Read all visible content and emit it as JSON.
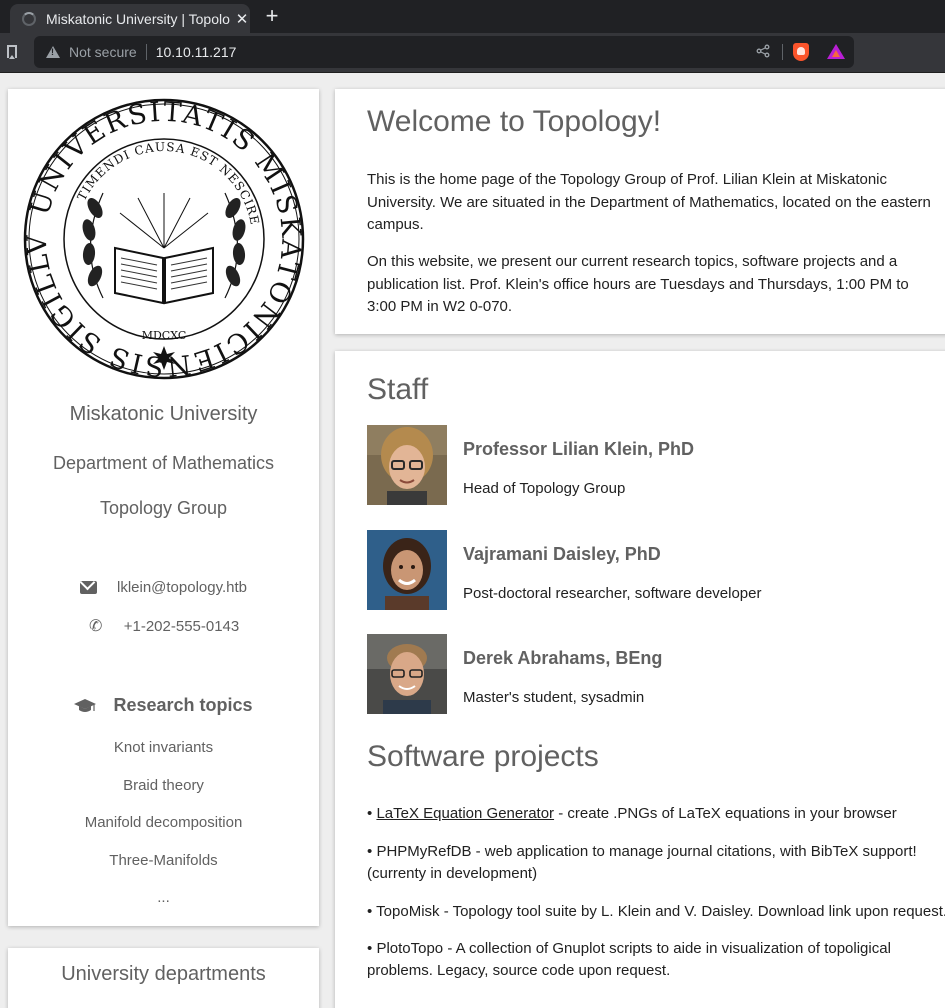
{
  "browser": {
    "tab_title": "Miskatonic University | Topology Group",
    "security_label": "Not secure",
    "url": "10.10.11.217"
  },
  "sidebar": {
    "seal": {
      "outer_text": "UNIVERSITATIS MISKATONICIENSIS SIGILLVM",
      "inner_text": "TIMENDI CAUSA EST NESCIRE",
      "year": "MDCXC"
    },
    "university": "Miskatonic University",
    "department": "Department of Mathematics",
    "group": "Topology Group",
    "email": "lklein@topology.htb",
    "phone": "+1-202-555-0143",
    "research_heading": "Research topics",
    "research_topics": [
      "Knot invariants",
      "Braid theory",
      "Manifold decomposition",
      "Three-Manifolds",
      "..."
    ],
    "departments_heading": "University departments"
  },
  "welcome": {
    "title": "Welcome to Topology!",
    "paragraphs": [
      "This is the home page of the Topology Group of Prof. Lilian Klein at Miskatonic University. We are situated in the Department of Mathematics, located on the eastern campus.",
      "On this website, we present our current research topics, software projects and a publication list. Prof. Klein's office hours are Tuesdays and Thursdays, 1:00 PM to 3:00 PM in W2 0-070."
    ]
  },
  "staff": {
    "title": "Staff",
    "members": [
      {
        "name": "Professor Lilian Klein, PhD",
        "role": "Head of Topology Group"
      },
      {
        "name": "Vajramani Daisley, PhD",
        "role": "Post-doctoral researcher, software developer"
      },
      {
        "name": "Derek Abrahams, BEng",
        "role": "Master's student, sysadmin"
      }
    ]
  },
  "software": {
    "title": "Software projects",
    "bullet": "•",
    "items": [
      {
        "link": "LaTeX Equation Generator",
        "text": " - create .PNGs of LaTeX equations in your browser"
      },
      {
        "text": "PHPMyRefDB - web application to manage journal citations, with BibTeX support! (currenty in development)"
      },
      {
        "text": "TopoMisk - Topology tool suite by L. Klein and V. Daisley. Download link upon request."
      },
      {
        "text": "PlotoTopo - A collection of Gnuplot scripts to aide in visualization of topoligical problems. Legacy, source code upon request."
      }
    ]
  }
}
